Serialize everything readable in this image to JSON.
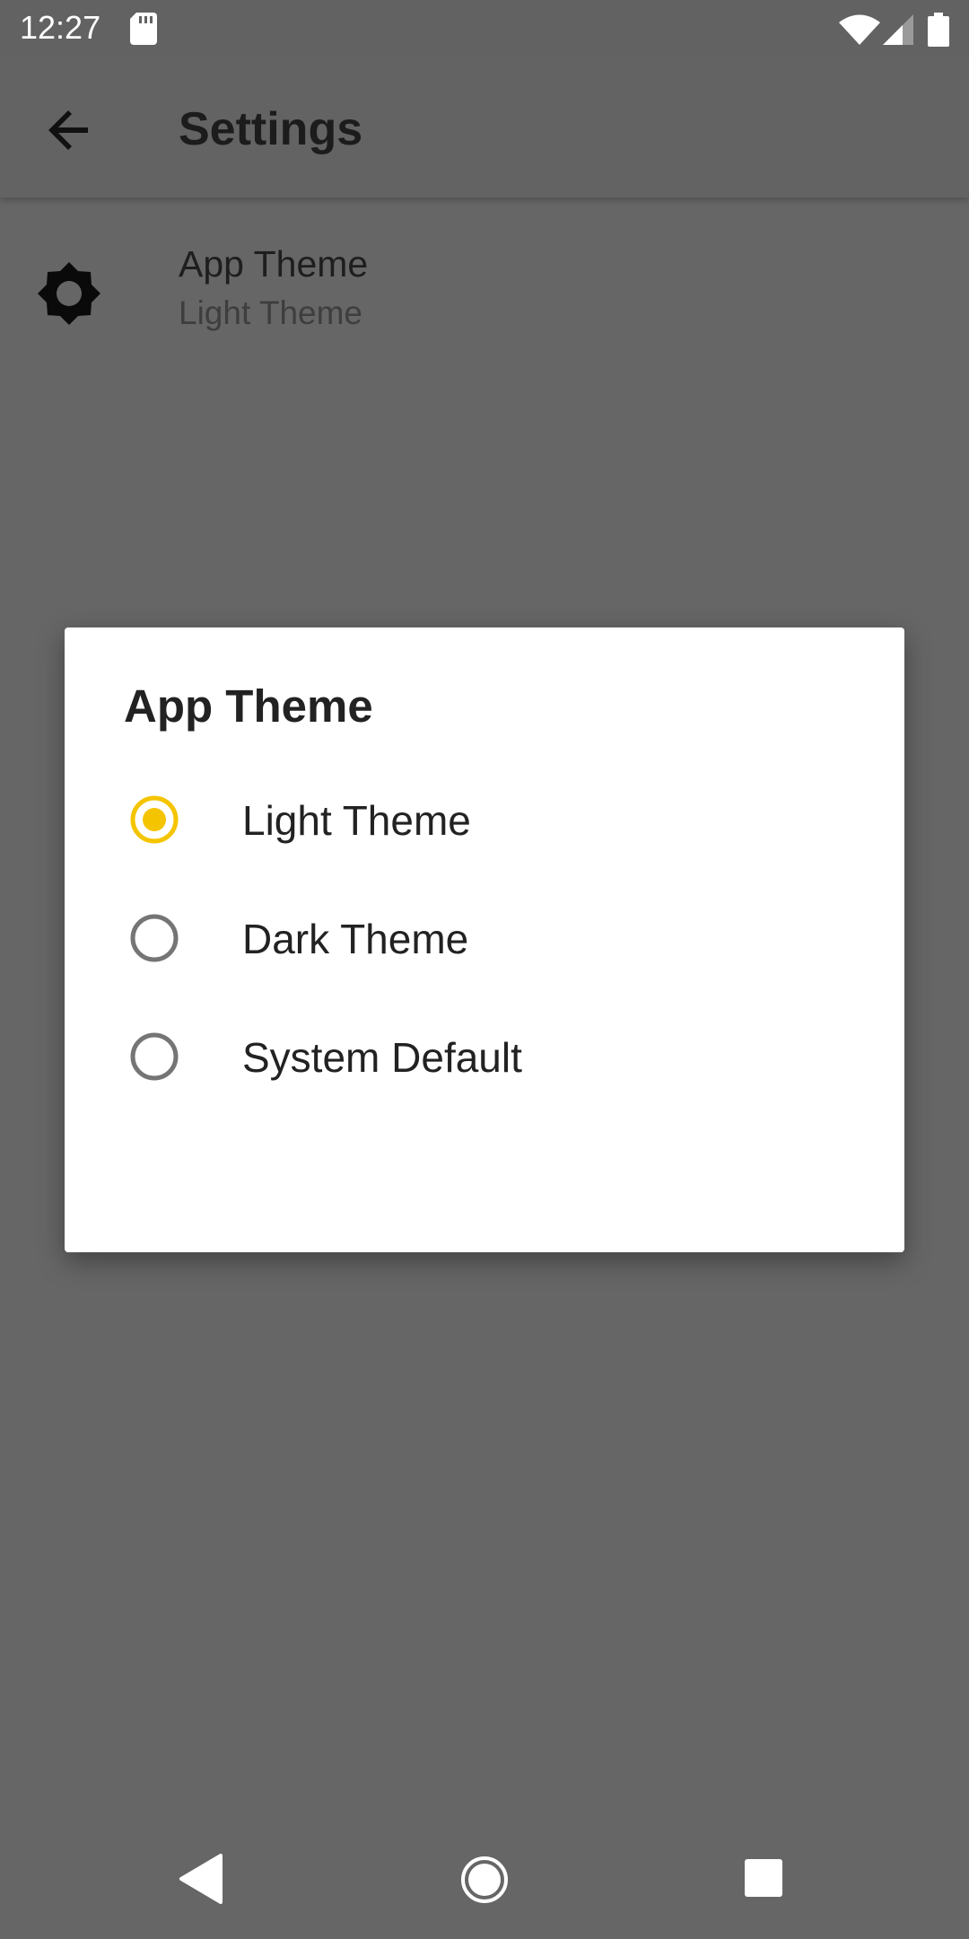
{
  "status_bar": {
    "time": "12:27",
    "icons": [
      "sd-card-icon",
      "wifi-icon",
      "signal-icon",
      "battery-icon"
    ],
    "icon_color": "#ffffff"
  },
  "app_bar": {
    "title": "Settings",
    "back_icon": "arrow-left-icon"
  },
  "settings": {
    "items": [
      {
        "icon": "brightness-icon",
        "title": "App Theme",
        "subtitle": "Light Theme"
      }
    ]
  },
  "dialog": {
    "title": "App Theme",
    "options": [
      {
        "label": "Light Theme",
        "selected": true
      },
      {
        "label": "Dark Theme",
        "selected": false
      },
      {
        "label": "System Default",
        "selected": false
      }
    ],
    "accent_color": "#f5c400",
    "unselected_color": "#757575"
  },
  "nav_bar": {
    "buttons": [
      "back-triangle-icon",
      "home-circle-icon",
      "recents-square-icon"
    ],
    "icon_color": "#ffffff"
  },
  "colors": {
    "scrim_background": "#666666",
    "dialog_background": "#ffffff",
    "text_primary": "#222222"
  }
}
